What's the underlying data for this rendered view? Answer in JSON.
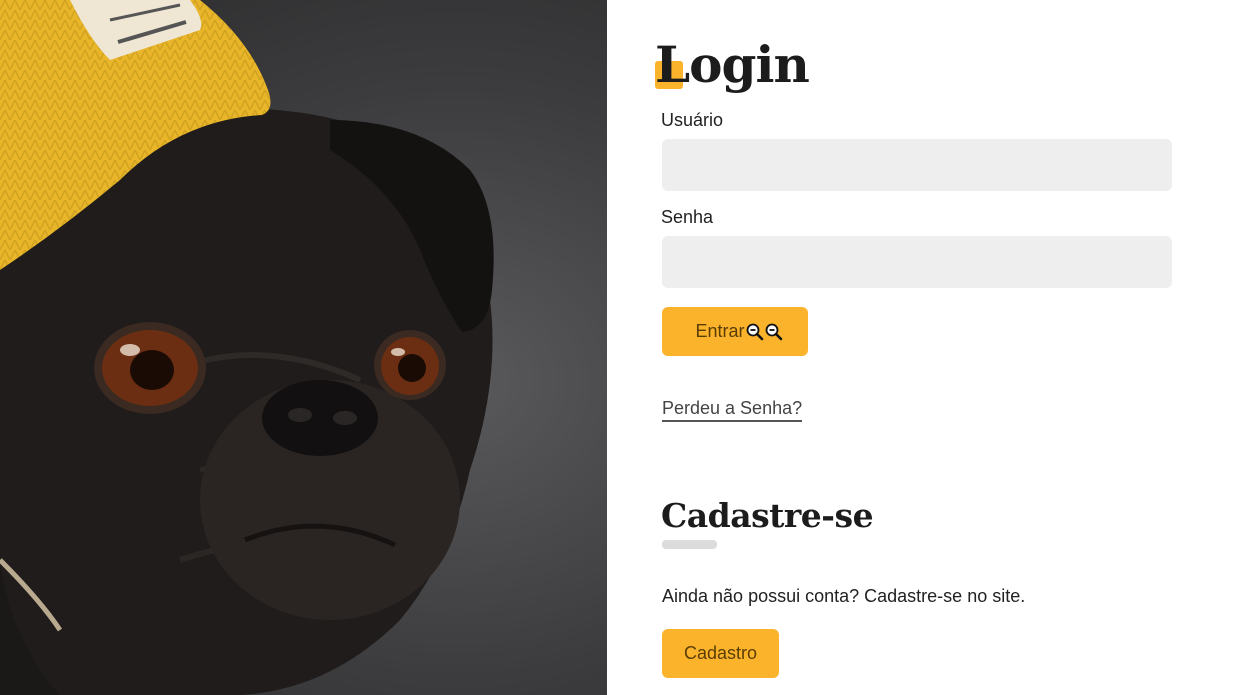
{
  "photo": {
    "alt": "Pug wearing a yellow knit hat"
  },
  "login": {
    "title": "Login",
    "username_label": "Usuário",
    "username_value": "",
    "password_label": "Senha",
    "password_value": "",
    "submit_label": "Entrar",
    "forgot_link": "Perdeu a Senha?"
  },
  "signup": {
    "title": "Cadastre-se",
    "text": "Ainda não possui conta? Cadastre-se no site.",
    "button_label": "Cadastro"
  },
  "colors": {
    "accent": "#fbb32c",
    "field_bg": "#eeeeee",
    "divider": "#dcdcdc"
  },
  "icons": [
    "zoom-out-icon",
    "zoom-out-icon"
  ]
}
